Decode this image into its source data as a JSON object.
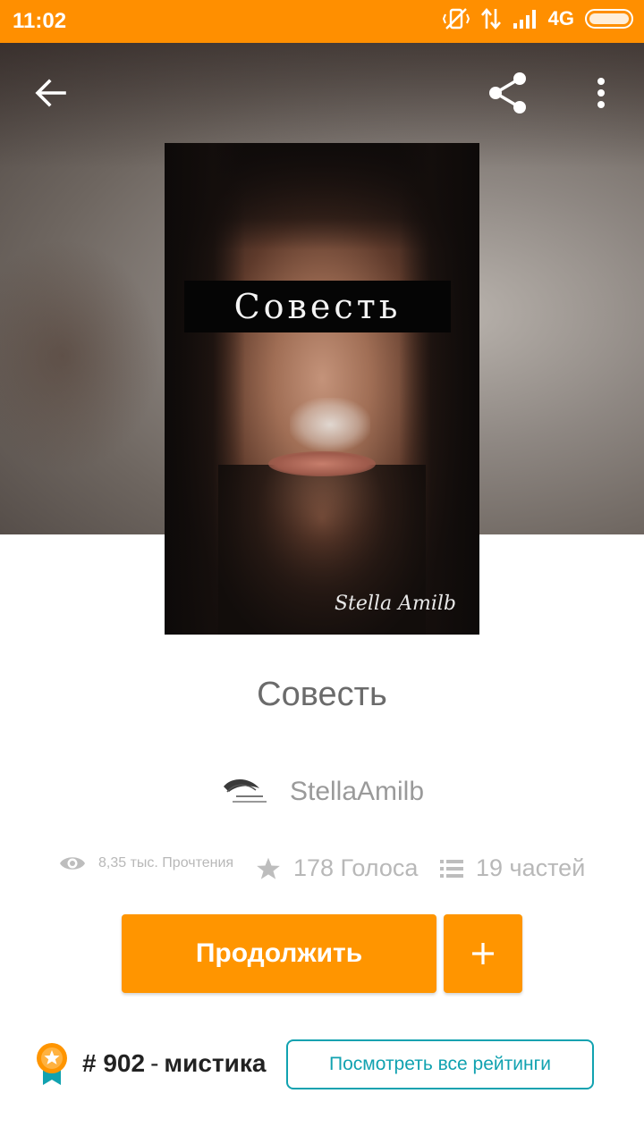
{
  "status_bar": {
    "time": "11:02",
    "network": "4G",
    "accent_color": "#ff8f00"
  },
  "toolbar": {
    "back_icon": "arrow-left-icon",
    "share_icon": "share-icon",
    "more_icon": "more-vertical-icon"
  },
  "cover": {
    "title": "Совесть",
    "signature": "Stella Amilb"
  },
  "story": {
    "title": "Совесть",
    "author": "StellaAmilb"
  },
  "stats": {
    "reads": "8,35 тыс. Прочтения",
    "votes": "178 Голоса",
    "parts": "19 частей"
  },
  "actions": {
    "continue_label": "Продолжить",
    "add_icon": "plus-icon",
    "button_color": "#ff9500"
  },
  "ranking": {
    "rank": "# 902",
    "separator": "-",
    "genre": "мистика",
    "view_all_label": "Посмотреть все рейтинги",
    "link_color": "#11a2b0"
  }
}
